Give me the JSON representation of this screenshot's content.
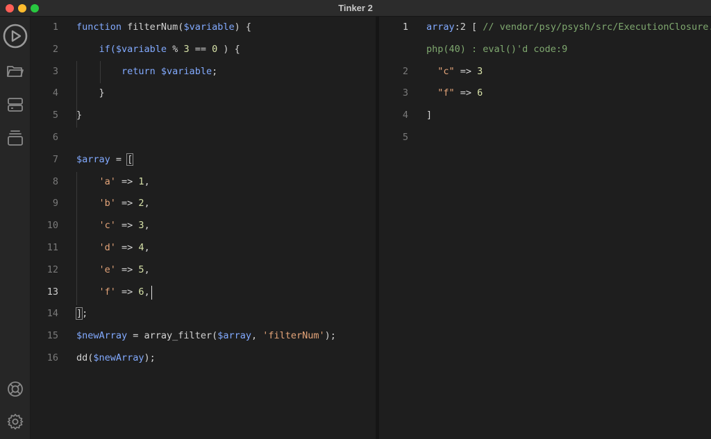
{
  "window": {
    "title": "Tinker 2"
  },
  "sidebar": {
    "icons": [
      "play-icon",
      "folder-icon",
      "server-icon",
      "archive-icon",
      "help-icon",
      "gear-icon"
    ]
  },
  "editor": {
    "active_line": 13,
    "lines": [
      {
        "n": "1",
        "tokens": [
          {
            "t": "function",
            "c": "kw"
          },
          {
            "t": " filterNum(",
            "c": "plain"
          },
          {
            "t": "$variable",
            "c": "var"
          },
          {
            "t": ") {",
            "c": "plain"
          }
        ]
      },
      {
        "n": "2",
        "tokens": [
          {
            "t": "    if(",
            "c": "kw"
          },
          {
            "t": "$variable",
            "c": "var"
          },
          {
            "t": " % ",
            "c": "plain"
          },
          {
            "t": "3",
            "c": "num"
          },
          {
            "t": " == ",
            "c": "plain"
          },
          {
            "t": "0",
            "c": "num"
          },
          {
            "t": " ) {",
            "c": "plain"
          }
        ]
      },
      {
        "n": "3",
        "tokens": [
          {
            "t": "        return ",
            "c": "kw"
          },
          {
            "t": "$variable",
            "c": "var"
          },
          {
            "t": ";",
            "c": "plain"
          }
        ]
      },
      {
        "n": "4",
        "tokens": [
          {
            "t": "    }",
            "c": "plain"
          }
        ]
      },
      {
        "n": "5",
        "tokens": [
          {
            "t": "}",
            "c": "plain"
          }
        ]
      },
      {
        "n": "6",
        "tokens": []
      },
      {
        "n": "7",
        "tokens": [
          {
            "t": "$array",
            "c": "var"
          },
          {
            "t": " = ",
            "c": "plain"
          },
          {
            "t": "[",
            "c": "plain",
            "hl": true
          }
        ]
      },
      {
        "n": "8",
        "tokens": [
          {
            "t": "    'a'",
            "c": "str"
          },
          {
            "t": " => ",
            "c": "plain"
          },
          {
            "t": "1",
            "c": "num"
          },
          {
            "t": ",",
            "c": "plain"
          }
        ]
      },
      {
        "n": "9",
        "tokens": [
          {
            "t": "    'b'",
            "c": "str"
          },
          {
            "t": " => ",
            "c": "plain"
          },
          {
            "t": "2",
            "c": "num"
          },
          {
            "t": ",",
            "c": "plain"
          }
        ]
      },
      {
        "n": "10",
        "tokens": [
          {
            "t": "    'c'",
            "c": "str"
          },
          {
            "t": " => ",
            "c": "plain"
          },
          {
            "t": "3",
            "c": "num"
          },
          {
            "t": ",",
            "c": "plain"
          }
        ]
      },
      {
        "n": "11",
        "tokens": [
          {
            "t": "    'd'",
            "c": "str"
          },
          {
            "t": " => ",
            "c": "plain"
          },
          {
            "t": "4",
            "c": "num"
          },
          {
            "t": ",",
            "c": "plain"
          }
        ]
      },
      {
        "n": "12",
        "tokens": [
          {
            "t": "    'e'",
            "c": "str"
          },
          {
            "t": " => ",
            "c": "plain"
          },
          {
            "t": "5",
            "c": "num"
          },
          {
            "t": ",",
            "c": "plain"
          }
        ]
      },
      {
        "n": "13",
        "tokens": [
          {
            "t": "    'f'",
            "c": "str"
          },
          {
            "t": " => ",
            "c": "plain"
          },
          {
            "t": "6",
            "c": "num"
          },
          {
            "t": ",",
            "c": "plain"
          }
        ]
      },
      {
        "n": "14",
        "tokens": [
          {
            "t": "]",
            "c": "plain",
            "hl": true
          },
          {
            "t": ";",
            "c": "plain"
          }
        ]
      },
      {
        "n": "15",
        "tokens": [
          {
            "t": "$newArray",
            "c": "var"
          },
          {
            "t": " = array_filter(",
            "c": "plain"
          },
          {
            "t": "$array",
            "c": "var"
          },
          {
            "t": ", ",
            "c": "plain"
          },
          {
            "t": "'filterNum'",
            "c": "str"
          },
          {
            "t": ");",
            "c": "plain"
          }
        ]
      },
      {
        "n": "16",
        "tokens": [
          {
            "t": "dd(",
            "c": "plain"
          },
          {
            "t": "$newArray",
            "c": "var"
          },
          {
            "t": ");",
            "c": "plain"
          }
        ]
      }
    ]
  },
  "output": {
    "lines": [
      {
        "n": "1",
        "active": true,
        "tokens": [
          {
            "t": "array",
            "c": "kw"
          },
          {
            "t": ":2 [ ",
            "c": "plain"
          },
          {
            "t": "// vendor/psy/psysh/src/ExecutionClosure.",
            "c": "cmt"
          }
        ]
      },
      {
        "n": "",
        "tokens": [
          {
            "t": "php(40) : eval()'d code:9",
            "c": "cmt"
          }
        ]
      },
      {
        "n": "2",
        "tokens": [
          {
            "t": "  \"c\"",
            "c": "str"
          },
          {
            "t": " => ",
            "c": "plain"
          },
          {
            "t": "3",
            "c": "num"
          }
        ]
      },
      {
        "n": "3",
        "tokens": [
          {
            "t": "  \"f\"",
            "c": "str"
          },
          {
            "t": " => ",
            "c": "plain"
          },
          {
            "t": "6",
            "c": "num"
          }
        ]
      },
      {
        "n": "4",
        "tokens": [
          {
            "t": "]",
            "c": "plain"
          }
        ]
      },
      {
        "n": "5",
        "tokens": []
      }
    ]
  }
}
